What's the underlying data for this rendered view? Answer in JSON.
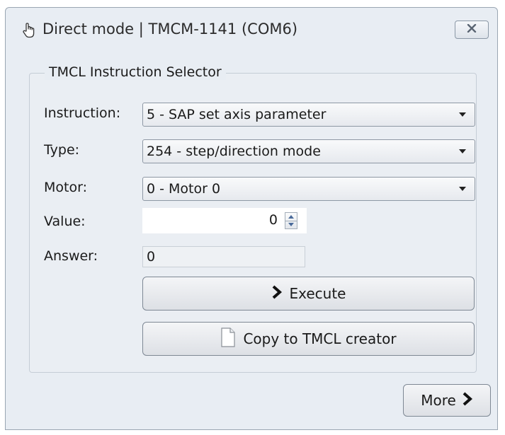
{
  "window": {
    "title": "Direct mode | TMCM-1141 (COM6)",
    "close_icon": "close-icon"
  },
  "group": {
    "title": "TMCL Instruction Selector"
  },
  "fields": {
    "instruction": {
      "label": "Instruction:",
      "value": "5 - SAP set axis parameter"
    },
    "type": {
      "label": "Type:",
      "value": "254 - step/direction mode"
    },
    "motor": {
      "label": "Motor:",
      "value": "0 - Motor 0"
    },
    "value": {
      "label": "Value:",
      "value": "0"
    },
    "answer": {
      "label": "Answer:",
      "value": "0"
    }
  },
  "buttons": {
    "execute": {
      "label": "Execute",
      "icon": "chevron-right-icon"
    },
    "copy": {
      "label": "Copy to TMCL creator",
      "icon": "document-icon"
    },
    "more": {
      "label": "More",
      "icon": "chevron-right-icon"
    }
  }
}
